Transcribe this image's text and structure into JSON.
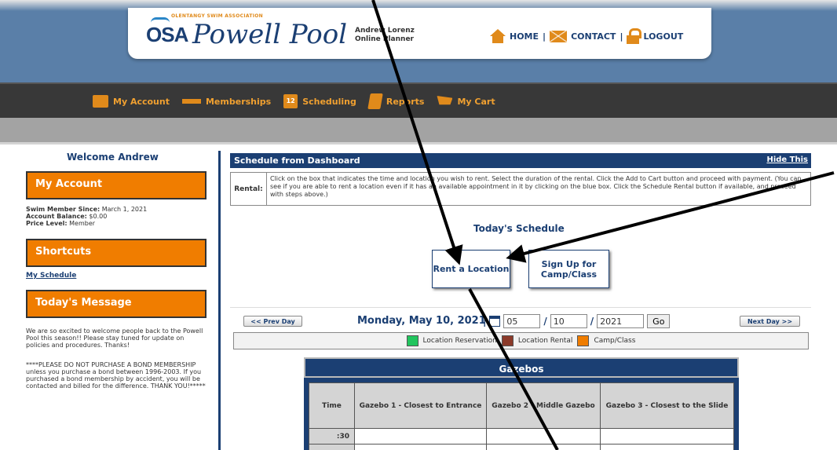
{
  "header": {
    "association": "OLENTANGY SWIM ASSOCIATION",
    "logo_mark": "OSA",
    "site_name": "Powell Pool",
    "user_name": "Andrew Lorenz",
    "user_role": "Online Planner",
    "links": {
      "home": "HOME",
      "contact": "CONTACT",
      "logout": "LOGOUT",
      "separator": "|"
    }
  },
  "nav": {
    "my_account": "My Account",
    "memberships": "Memberships",
    "scheduling": "Scheduling",
    "scheduling_badge": "12",
    "reports": "Reports",
    "my_cart": "My Cart"
  },
  "sidebar": {
    "welcome": "Welcome Andrew",
    "my_account_title": "My Account",
    "member_since_label": "Swim Member Since:",
    "member_since_value": "March 1, 2021",
    "balance_label": "Account Balance:",
    "balance_value": "$0.00",
    "price_level_label": "Price Level:",
    "price_level_value": "Member",
    "shortcuts_title": "Shortcuts",
    "my_schedule_link": "My Schedule",
    "todays_message_title": "Today's Message",
    "message_1": "We are so excited to welcome people back to the Powell Pool this season!!  Please stay tuned for update on policies and procedures.  Thanks!",
    "message_2": "****PLEASE DO NOT PURCHASE A BOND MEMBERSHIP unless you purchase a bond between 1996-2003.  If you purchased a bond membership by accident, you will be contacted and billed for the difference.  THANK YOU!*****"
  },
  "main": {
    "schedule_header": "Schedule from Dashboard",
    "hide_this": "Hide This",
    "rental_label": "Rental:",
    "rental_text": "Click on the box that indicates the time and location you wish to rent. Select the duration of the rental. Click the Add to Cart button and proceed with payment. (You can see if you are able to rent a location even if it has an available appointment in it by clicking on the blue box. Click the Schedule Rental button if available, and proceed with steps above.)",
    "todays_schedule": "Today's Schedule",
    "rent_location_button": "Rent a Location",
    "signup_button": "Sign Up for Camp/Class",
    "prev_day": "<< Prev Day",
    "next_day": "Next Day >>",
    "date_title": "Monday, May 10, 2021",
    "month": "05",
    "day": "10",
    "year": "2021",
    "go": "Go",
    "legend": [
      {
        "label": "Location Reservation",
        "color": "#22c55e"
      },
      {
        "label": "Location Rental",
        "color": "#8b3a2a"
      },
      {
        "label": "Camp/Class",
        "color": "#f07d00"
      }
    ],
    "table_title": "Gazebos",
    "columns": [
      "Time",
      "Gazebo 1 - Closest to Entrance",
      "Gazebo 2 - Middle Gazebo",
      "Gazebo 3 - Closest to the Slide"
    ],
    "rows": [
      ":30",
      ""
    ]
  },
  "colors": {
    "navy": "#1b3f73",
    "orange": "#f07d00",
    "header_blue": "#5a7fa8",
    "nav_dark": "#383838"
  }
}
